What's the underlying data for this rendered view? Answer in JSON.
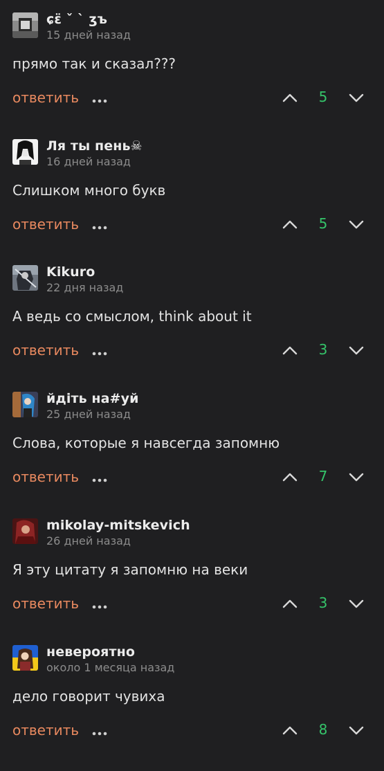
{
  "labels": {
    "reply": "ответить"
  },
  "icons": {
    "more": "more-horizontal-icon",
    "upvote": "chevron-up-icon",
    "downvote": "chevron-down-icon"
  },
  "colors": {
    "background": "#1f1f21",
    "reply": "#e8895f",
    "score": "#35c46a"
  },
  "comments": [
    {
      "username": "ɕɛ̈ ˇ ˋ ʒъ",
      "date": "15 дней назад",
      "text": "прямо так и сказал???",
      "score": "5"
    },
    {
      "username": "Ля ты пень☠",
      "date": "16 дней назад",
      "text": "Слишком много букв",
      "score": "5"
    },
    {
      "username": "Kikuro",
      "date": "22 дня назад",
      "text": "А ведь со смыслом, think about it",
      "score": "3"
    },
    {
      "username": "йдіть на#уй",
      "date": "25 дней назад",
      "text": "Слова, которые я навсегда запомню",
      "score": "7"
    },
    {
      "username": "mikolay-mitskevich",
      "date": "26 дней назад",
      "text": "Я эту цитату я запомню на веки",
      "score": "3"
    },
    {
      "username": "невероятно",
      "date": "около 1 месяца назад",
      "text": "дело говорит чувиха",
      "score": "8"
    }
  ]
}
